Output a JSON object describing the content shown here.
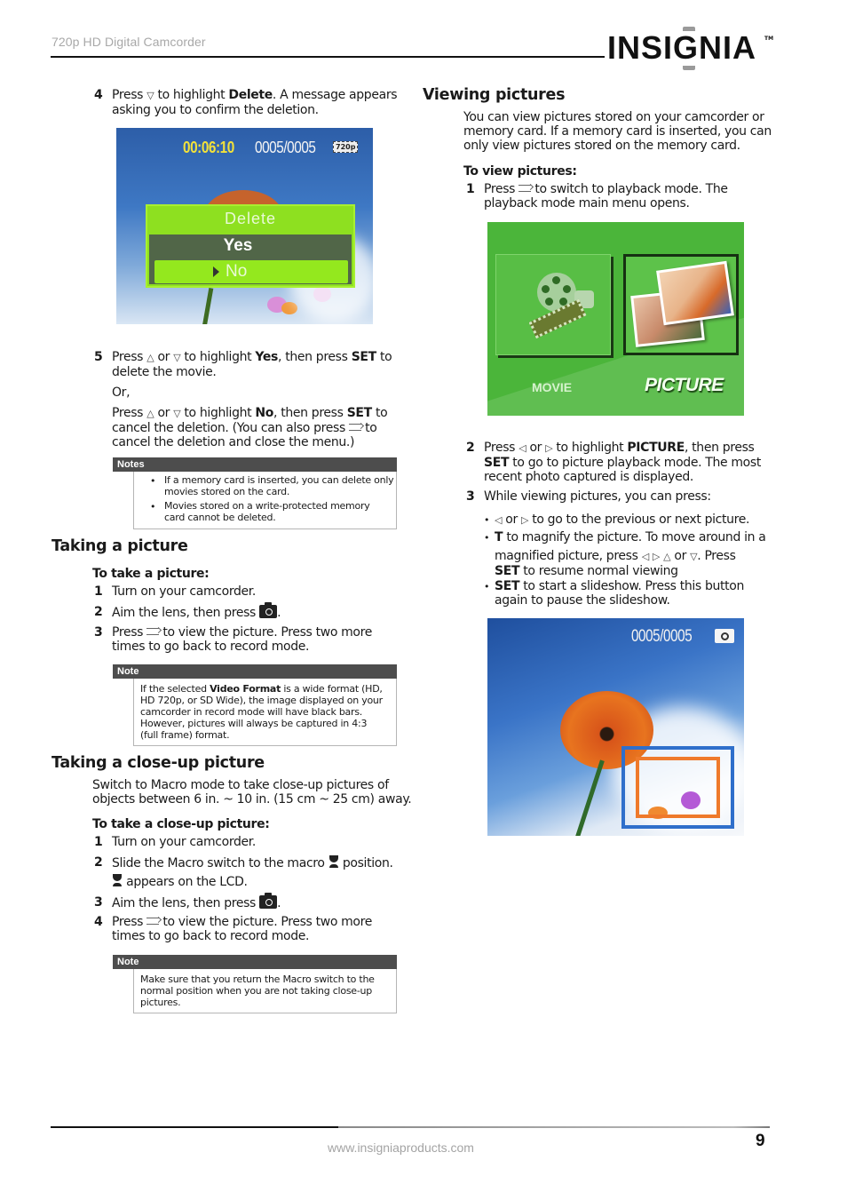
{
  "header": {
    "doc_title": "720p HD Digital Camcorder",
    "logo_text": "INSIGNIA",
    "logo_tm": "TM"
  },
  "left": {
    "step4": {
      "num": "4",
      "pre": "Press",
      "mid": "to highlight",
      "bold": "Delete",
      "post": ". A message appears",
      "line2": "asking you to confirm the deletion."
    },
    "delete_screen": {
      "time": "00:06:10",
      "counter": "0005/0005",
      "resolution": "720p",
      "menu_title": "Delete",
      "option_yes": "Yes",
      "option_no": "No",
      "selected": "No"
    },
    "step5": {
      "num": "5",
      "l1_a": "Press",
      "l1_or": "or",
      "l1_b": "to highlight",
      "l1_yes": "Yes",
      "l1_c": ", then press",
      "l1_set": "SET",
      "l1_d": "to",
      "l2": "delete the movie.",
      "or": "Or,",
      "l3_a": "Press",
      "l3_or": "or",
      "l3_b": "to highlight",
      "l3_no": "No",
      "l3_c": ", then press",
      "l3_set": "SET",
      "l3_d": "to",
      "l4_a": "cancel the deletion. (You can also press",
      "l4_b": "to",
      "l5": "cancel the deletion and close the menu.)"
    },
    "notes1": {
      "label": "Notes",
      "items": [
        [
          "If a memory card is inserted, you can delete only",
          "movies stored on the card."
        ],
        [
          "Movies stored on a write-protected memory",
          "card cannot be deleted."
        ]
      ]
    },
    "taking_picture": {
      "heading": "Taking a picture",
      "subheading": "To take a picture:",
      "steps": [
        {
          "num": "1",
          "text": "Turn on your camcorder."
        },
        {
          "num": "2",
          "text": "Aim the lens, then press",
          "suffix": "."
        },
        {
          "num": "3",
          "pre": "Press",
          "text": "to view the picture. Press two more",
          "line2": "times to go back to record mode."
        }
      ]
    },
    "note2": {
      "label": "Note",
      "l1_a": "If the selected",
      "l1_bold": "Video Format",
      "l1_b": "is a wide format (HD,",
      "l2": "HD 720p, or SD Wide), the image displayed on your",
      "l3": "camcorder in record mode will have black bars.",
      "l4": "However, pictures will always be captured in 4:3",
      "l5": "(full frame) format."
    },
    "closeup": {
      "heading": "Taking a close-up picture",
      "intro_l1": "Switch to Macro mode to take close-up pictures of",
      "intro_l2": "objects between 6 in. ~ 10 in. (15 cm ~ 25 cm) away.",
      "subheading": "To take a close-up picture:",
      "steps": [
        {
          "num": "1",
          "text": "Turn on your camcorder."
        },
        {
          "num": "2",
          "text": "Slide the Macro switch to the macro",
          "suffix": "position.",
          "line2": "appears on the LCD."
        },
        {
          "num": "3",
          "text": "Aim the lens, then press",
          "suffix": "."
        },
        {
          "num": "4",
          "pre": "Press",
          "text": "to view the picture. Press two more",
          "line2": "times to go back to record mode."
        }
      ]
    },
    "note3": {
      "label": "Note",
      "l1": "Make sure that you return the Macro switch to the",
      "l2": "normal position when you are not taking close-up",
      "l3": "pictures."
    }
  },
  "right": {
    "viewing": {
      "heading": "Viewing pictures",
      "intro_l1": "You can view pictures stored on your camcorder or",
      "intro_l2": "memory card. If a memory card is inserted, you can",
      "intro_l3": "only view pictures stored on the memory card.",
      "subheading": "To view pictures:",
      "step1": {
        "num": "1",
        "pre": "Press",
        "text": "to switch to playback mode. The",
        "line2": "playback mode main menu opens."
      }
    },
    "playback_screen": {
      "movie_label": "MOVIE",
      "picture_label": "PICTURE",
      "selected": "PICTURE"
    },
    "step2": {
      "num": "2",
      "a": "Press",
      "or": "or",
      "b": "to highlight",
      "bold": "PICTURE",
      "c": ", then press",
      "l2_set": "SET",
      "l2": "to go to picture playback mode. The most",
      "l3": "recent photo captured is displayed."
    },
    "step3": {
      "num": "3",
      "text": "While viewing pictures, you can press:",
      "bullets": {
        "b1_or": "or",
        "b1_text": "to go to the previous or next picture.",
        "b2_bold": "T",
        "b2_text": "to magnify the picture. To move around in a",
        "b2_l2_a": "magnified picture, press",
        "b2_l2_or": "or",
        "b2_l2_b": ". Press",
        "b2_l3_set": "SET",
        "b2_l3": "to resume normal viewing",
        "b3_set": "SET",
        "b3_text": "to start a slideshow. Press this button",
        "b3_l2": "again to pause the slideshow."
      }
    },
    "zoom_screen": {
      "counter": "0005/0005"
    }
  },
  "symbols": {
    "up": "△",
    "down": "▽",
    "left": "◁",
    "right": "▷",
    "bullet": "•"
  },
  "footer": {
    "url": "www.insigniaproducts.com",
    "page_number": "9"
  }
}
